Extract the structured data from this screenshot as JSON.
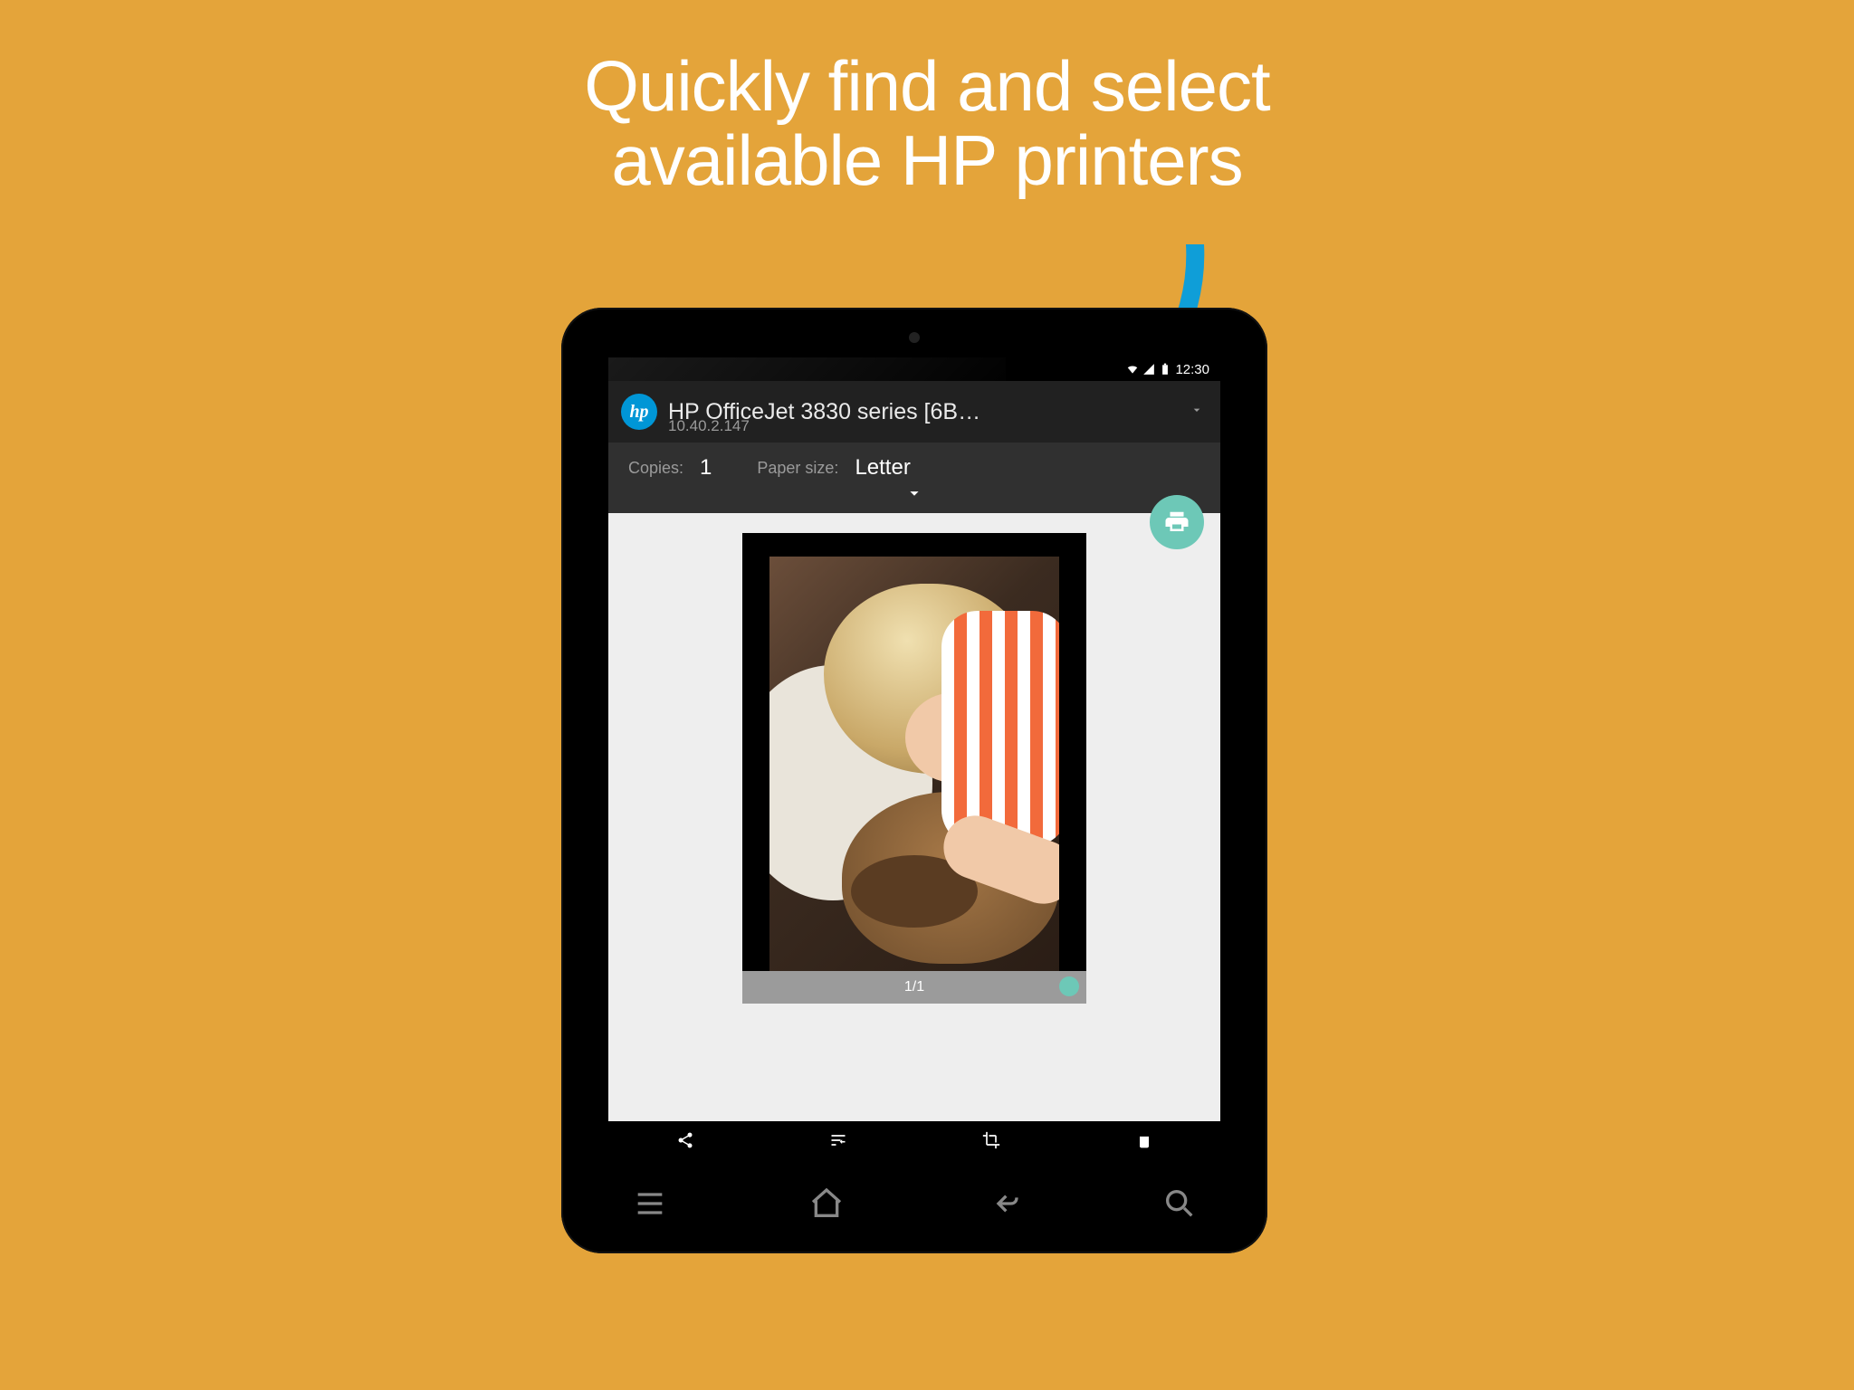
{
  "headline_line1": "Quickly find and select",
  "headline_line2": "available HP printers",
  "status": {
    "time": "12:30"
  },
  "printer": {
    "name": "HP OfficeJet 3830 series [6B…",
    "ip": "10.40.2.147",
    "badge_text": "hp"
  },
  "options": {
    "copies_label": "Copies:",
    "copies_value": "1",
    "paper_label": "Paper size:",
    "paper_value": "Letter"
  },
  "preview": {
    "page_indicator": "1/1"
  },
  "colors": {
    "bg": "#e4a43a",
    "accent": "#6dc8b7",
    "hp_blue": "#0096d6",
    "arrow": "#0f9ed8"
  }
}
